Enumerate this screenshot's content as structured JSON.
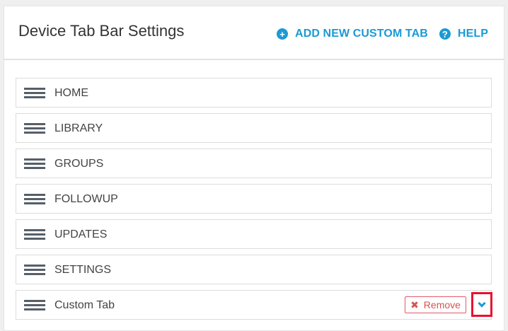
{
  "header": {
    "title": "Device Tab Bar Settings",
    "add_label": "ADD NEW CUSTOM TAB",
    "help_label": "HELP",
    "add_icon_glyph": "+",
    "help_icon_glyph": "?"
  },
  "tabs": [
    {
      "label": "HOME"
    },
    {
      "label": "LIBRARY"
    },
    {
      "label": "GROUPS"
    },
    {
      "label": "FOLLOWUP"
    },
    {
      "label": "UPDATES"
    },
    {
      "label": "SETTINGS"
    },
    {
      "label": "Custom Tab",
      "custom": true
    }
  ],
  "custom_tab": {
    "remove_label": "Remove",
    "remove_icon": "✖"
  },
  "icons": {
    "drag": "drag-handle-icon",
    "add": "plus-circle-icon",
    "help": "question-circle-icon",
    "remove": "x-icon",
    "expand": "chevron-down-icon"
  },
  "colors": {
    "accent": "#1a9ad6",
    "danger": "#d9534f",
    "highlight": "#e8112d"
  }
}
